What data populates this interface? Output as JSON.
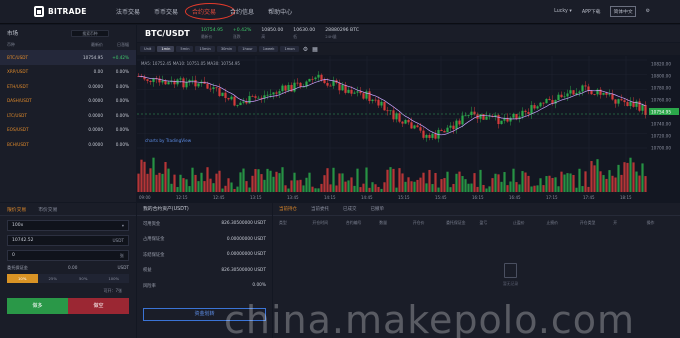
{
  "nav": {
    "logo": "BITRADE",
    "links": [
      "法币交易",
      "币币交易",
      "合约交易",
      "合约信息",
      "帮助中心"
    ],
    "user": "Lucky ▾",
    "app": "APP下载",
    "lang": "简体中文",
    "gear_icon": "gear-icon"
  },
  "markets": {
    "title": "市场",
    "search_placeholder": "搜索币种",
    "cols": [
      "币种",
      "最新价",
      "日涨幅"
    ],
    "rows": [
      {
        "sym": "BTC/USDT",
        "price": "10754.95",
        "chg": "+0.42%"
      },
      {
        "sym": "XRP/USDT",
        "price": "0.00",
        "chg": "0.00%"
      },
      {
        "sym": "ETH/USDT",
        "price": "0.0000",
        "chg": "0.00%"
      },
      {
        "sym": "DASH/USDT",
        "price": "0.0000",
        "chg": "0.00%"
      },
      {
        "sym": "LTC/USDT",
        "price": "0.0000",
        "chg": "0.00%"
      },
      {
        "sym": "EOS/USDT",
        "price": "0.0000",
        "chg": "0.00%"
      },
      {
        "sym": "BCH/USDT",
        "price": "0.0000",
        "chg": "0.00%"
      }
    ]
  },
  "header": {
    "pair": "BTC/USDT",
    "stats": [
      {
        "v": "10754.95",
        "l": "最新价",
        "green": true
      },
      {
        "v": "+0.42%",
        "l": "涨跌",
        "green": true
      },
      {
        "v": "10850.00",
        "l": "高",
        "green": false
      },
      {
        "v": "10630.00",
        "l": "低",
        "green": false
      },
      {
        "v": "28880296 BTC",
        "l": "24H量",
        "green": false
      }
    ]
  },
  "toolbar": {
    "buttons": [
      "Unit",
      "1min",
      "5min",
      "15min",
      "30min",
      "1hour",
      "1week",
      "1mon"
    ],
    "active": 1
  },
  "chart": {
    "ma_legend": "MA5: 10752.45  MA10: 10751.05  MA30: 10754.95",
    "credit": "charts by TradingView",
    "price_ticks": [
      "10820.00",
      "10800.00",
      "10780.00",
      "10760.00",
      "10754.95",
      "10740.00",
      "10720.00",
      "10700.00"
    ],
    "time_ticks": [
      "09:00",
      "12:15",
      "12:45",
      "13:15",
      "13:45",
      "14:15",
      "14:45",
      "15:15",
      "15:45",
      "16:15",
      "16:45",
      "17:15",
      "17:45",
      "18:15"
    ],
    "current_price": "10754.95",
    "colors": {
      "up": "#2ba84a",
      "down": "#d43b3b",
      "ma": "#c9a3ff"
    }
  },
  "order": {
    "tabs": [
      "限价交易",
      "市价交易"
    ],
    "leverage": "100x",
    "price": "10742.52",
    "price_unit": "USDT",
    "amount": "0",
    "amount_unit": "张",
    "margin_label": "委托保证金",
    "margin_value": "0.00",
    "margin_unit": "USDT",
    "pct": [
      "10%",
      "25%",
      "50%",
      "100%"
    ],
    "available": "可开：7张",
    "buy": "做多",
    "sell": "做空"
  },
  "assets": {
    "title": "我的合约资产(USDT)",
    "rows": [
      {
        "l": "可用资金",
        "v": "826.30500000 USDT"
      },
      {
        "l": "占用保证金",
        "v": "0.00000000 USDT"
      },
      {
        "l": "冻结保证金",
        "v": "0.00000000 USDT"
      },
      {
        "l": "权益",
        "v": "826.30500000 USDT"
      },
      {
        "l": "风险率",
        "v": "0.00%"
      }
    ],
    "transfer": "资金划转"
  },
  "positions": {
    "tabs": [
      "当前持仓",
      "当前委托",
      "已成交",
      "已撤单"
    ],
    "cols": [
      "类型",
      "开仓时间",
      "合约编号",
      "数量",
      "开仓价",
      "委托保证金",
      "盈亏",
      "止盈价",
      "止损价",
      "开仓类型",
      "开",
      "操作"
    ],
    "empty": "暂无记录"
  },
  "watermark": "china.makepolo.com"
}
